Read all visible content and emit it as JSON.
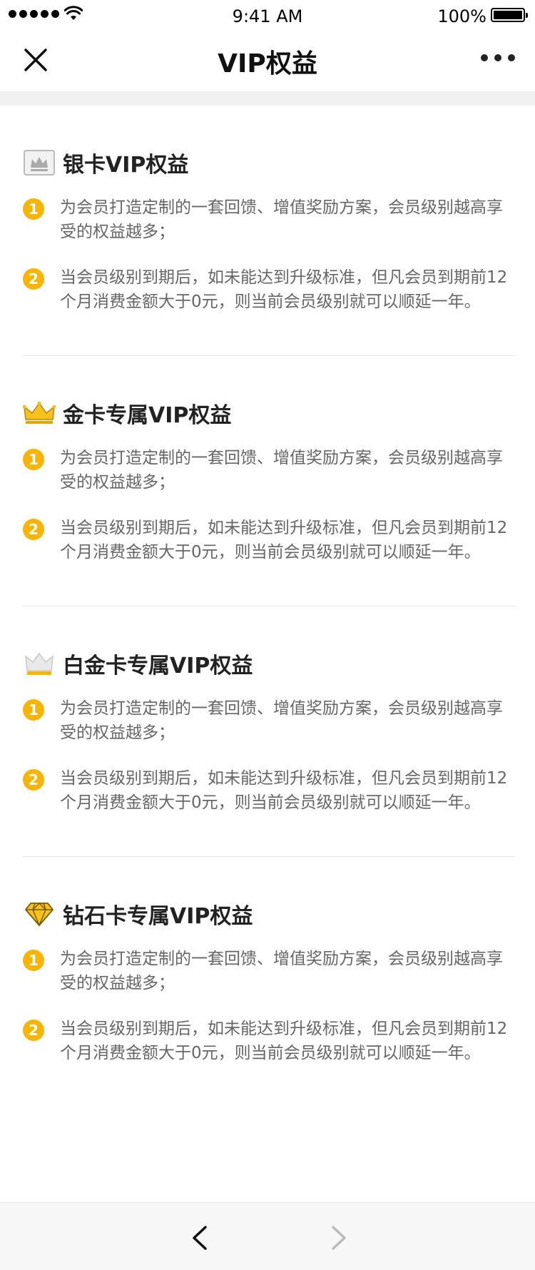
{
  "status_bar": {
    "time": "9:41 AM",
    "battery": "100%"
  },
  "nav": {
    "title": "VIP权益",
    "close_icon": "close-icon",
    "more_icon": "more-icon"
  },
  "sections": [
    {
      "title": "银卡VIP权益",
      "icon": "silver-crown-icon",
      "items": [
        {
          "num": "1",
          "text": "为会员打造定制的一套回馈、增值奖励方案，会员级别越高享受的权益越多；"
        },
        {
          "num": "2",
          "text": "当会员级别到期后，如未能达到升级标准，但凡会员到期前12个月消费金额大于0元，则当前会员级别就可以顺延一年。"
        }
      ]
    },
    {
      "title": "金卡专属VIP权益",
      "icon": "gold-crown-icon",
      "items": [
        {
          "num": "1",
          "text": "为会员打造定制的一套回馈、增值奖励方案，会员级别越高享受的权益越多；"
        },
        {
          "num": "2",
          "text": "当会员级别到期后，如未能达到升级标准，但凡会员到期前12个月消费金额大于0元，则当前会员级别就可以顺延一年。"
        }
      ]
    },
    {
      "title": "白金卡专属VIP权益",
      "icon": "platinum-crown-icon",
      "items": [
        {
          "num": "1",
          "text": "为会员打造定制的一套回馈、增值奖励方案，会员级别越高享受的权益越多；"
        },
        {
          "num": "2",
          "text": "当会员级别到期后，如未能达到升级标准，但凡会员到期前12个月消费金额大于0元，则当前会员级别就可以顺延一年。"
        }
      ]
    },
    {
      "title": "钻石卡专属VIP权益",
      "icon": "diamond-icon",
      "items": [
        {
          "num": "1",
          "text": "为会员打造定制的一套回馈、增值奖励方案，会员级别越高享受的权益越多；"
        },
        {
          "num": "2",
          "text": "当会员级别到期后，如未能达到升级标准，但凡会员到期前12个月消费金额大于0元，则当前会员级别就可以顺延一年。"
        }
      ]
    }
  ],
  "bottom_bar": {
    "back_icon": "chevron-left-icon",
    "forward_icon": "chevron-right-icon"
  },
  "colors": {
    "accent": "#f7b500",
    "text": "#666666",
    "title": "#222222",
    "divider": "#e6e6e6"
  }
}
